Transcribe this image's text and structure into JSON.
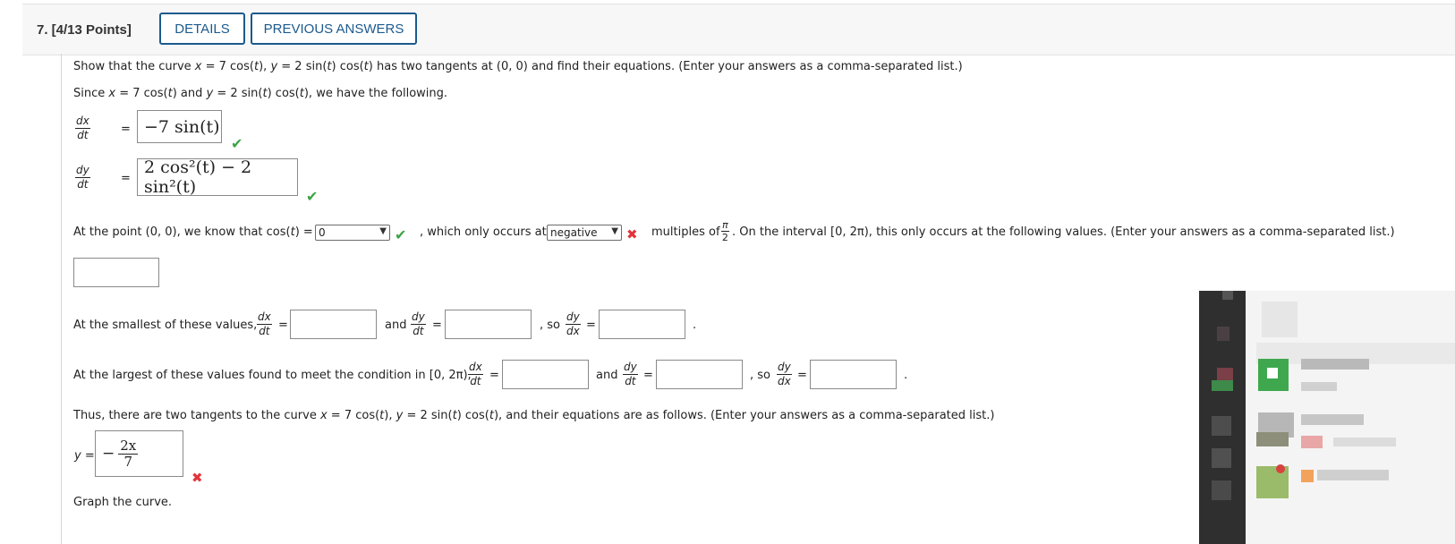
{
  "header": {
    "question": "7. [4/13 Points]",
    "details_label": "DETAILS",
    "previous_label": "PREVIOUS ANSWERS"
  },
  "problem": {
    "intro_a": "Show that the curve ",
    "x_var": "x",
    "eq1": " = 7 cos(",
    "t": "t",
    "eq2": "), ",
    "y_var": "y",
    "eq3": " = 2 sin(",
    "eq4": ") cos(",
    "eq5": ") has two tangents at (0, 0) and find their equations. (Enter your answers as a comma-separated list.)",
    "since_a": "Since ",
    "since_b": " = 7 cos(",
    "since_c": ") and ",
    "since_d": " = 2 sin(",
    "since_e": ") cos(",
    "since_f": "), we have the following."
  },
  "derivs": {
    "dx": "dx",
    "dy": "dy",
    "dt": "dt",
    "equals": "=",
    "dxdt_answer": "−7 sin(t)",
    "dydt_answer": "2 cos²(t) − 2 sin²(t)"
  },
  "point": {
    "text_a": "At the point (0, 0), we know that cos(",
    "text_b": ") = ",
    "select1_value": "0",
    "text_c": ", which only occurs at",
    "select2_value": "negative",
    "text_d": "multiples of",
    "pi": "π",
    "two": "2",
    "text_e": ". On the interval [0, 2π), this only occurs at the following values. (Enter your answers as a comma-separated list.)"
  },
  "smallest": {
    "text": "At the smallest of these values,",
    "and": "and",
    "so": ", so",
    "dydx_top": "dy",
    "dydx_bot": "dx",
    "period": "."
  },
  "largest": {
    "text": "At the largest of these values found to meet the condition in [0, 2π),",
    "and": "and",
    "so": ", so",
    "period": "."
  },
  "thus": {
    "text_a": "Thus, there are two tangents to the curve ",
    "text_b": " = 7 cos(",
    "text_c": "), ",
    "text_d": " = 2 sin(",
    "text_e": ") cos(",
    "text_f": "), and their equations are as follows. (Enter your answers as a comma-separated list.)",
    "y_label": "y =",
    "answer_minus": "−",
    "answer_num": "2x",
    "answer_den": "7"
  },
  "graph": {
    "text": "Graph the curve."
  },
  "icons": {
    "check": "check-icon",
    "cross": "cross-icon",
    "chevron": "chevron-down-icon"
  },
  "colors": {
    "accent": "#1c5a8d",
    "correct": "#3aa443",
    "wrong": "#e2343c"
  }
}
